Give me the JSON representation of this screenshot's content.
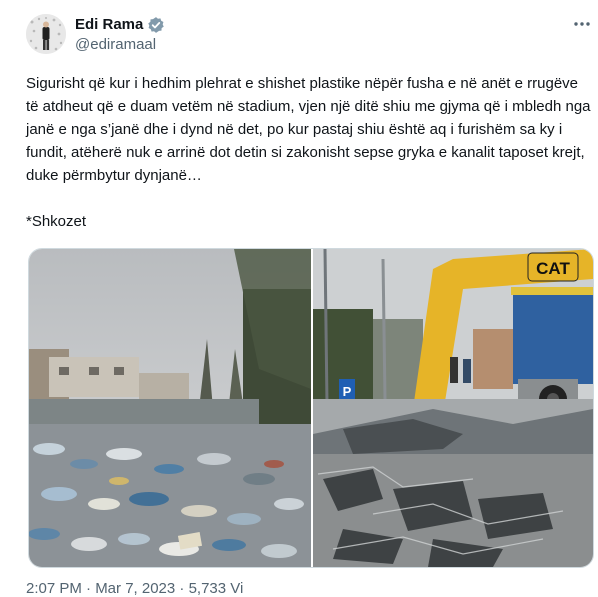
{
  "author": {
    "name": "Edi Rama",
    "handle": "@ediramaal",
    "verified": true
  },
  "tweet": {
    "text": "Sigurisht që kur i hedhim plehrat e shishet plastike nëpër fusha e në anët e rrugëve të atdheut që e duam vetëm në stadium, vjen një ditë shiu me gjyma që i mbledh nga janë e nga s’janë dhe i dynd në det, po kur pastaj shiu është aq i furishëm sa ky i fundit, atëherë nuk e arrinë dot detin si zakonisht sepse gryka e kanalit taposet krejt, duke përmbytur dynjanë…",
    "signature": "*Shkozet"
  },
  "media": {
    "photos": [
      {
        "subject": "plastic-waste-in-canal"
      },
      {
        "subject": "excavator-at-flooded-road",
        "sign_text": "CAT",
        "parking_sign": "P"
      }
    ]
  },
  "meta": {
    "partial_text": "2:07 PM · Mar 7, 2023 · 5,733 Vi"
  },
  "icons": {
    "verified": "verified-badge-icon",
    "more": "more-options-icon"
  },
  "colors": {
    "text": "#0f1419",
    "secondary": "#536471",
    "border": "#cfd9de",
    "badge": "#829aab"
  }
}
